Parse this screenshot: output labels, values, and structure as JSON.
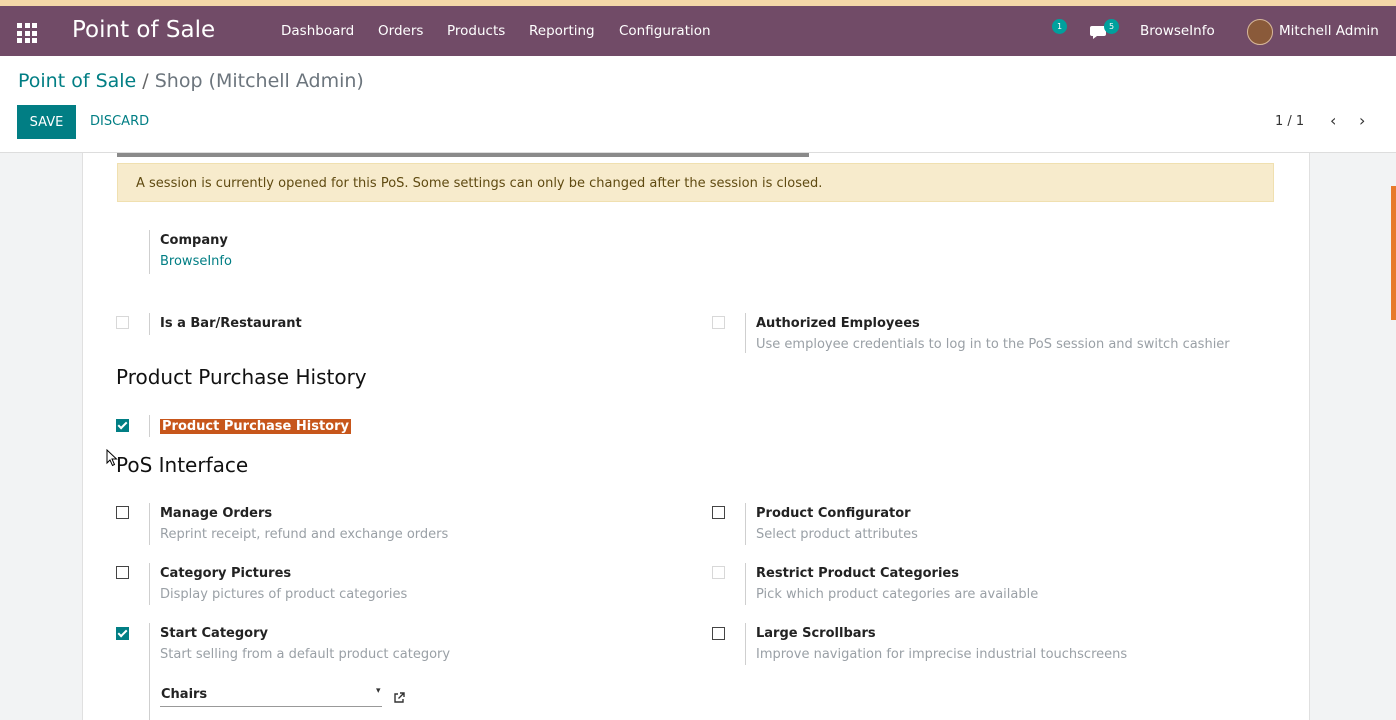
{
  "topbar": {
    "app_title": "Point of Sale",
    "menu": [
      "Dashboard",
      "Orders",
      "Products",
      "Reporting",
      "Configuration"
    ],
    "activity_count": "1",
    "messages_count": "5",
    "company": "BrowseInfo",
    "user": "Mitchell Admin",
    "colors": {
      "bar": "#714b67",
      "accent": "#017e84",
      "badge": "#00a09d"
    }
  },
  "control": {
    "breadcrumb_parent": "Point of Sale",
    "breadcrumb_sep": " / ",
    "breadcrumb_current": "Shop (Mitchell Admin)",
    "save_label": "SAVE",
    "discard_label": "DISCARD",
    "pager": "1 / 1"
  },
  "alert": "A session is currently opened for this PoS. Some settings can only be changed after the session is closed.",
  "company_field": {
    "label": "Company",
    "value": "BrowseInfo"
  },
  "settings_top": {
    "bar_restaurant": {
      "label": "Is a Bar/Restaurant",
      "checked": false
    },
    "authorized_employees": {
      "label": "Authorized Employees",
      "help": "Use employee credentials to log in to the PoS session and switch cashier",
      "checked": false
    }
  },
  "section_history": {
    "title": "Product Purchase History",
    "option_label": "Product Purchase History",
    "checked": true
  },
  "section_interface": {
    "title": "PoS Interface",
    "manage_orders": {
      "label": "Manage Orders",
      "help": "Reprint receipt, refund and exchange orders",
      "checked": false
    },
    "product_configurator": {
      "label": "Product Configurator",
      "help": "Select product attributes",
      "checked": false
    },
    "category_pictures": {
      "label": "Category Pictures",
      "help": "Display pictures of product categories",
      "checked": false
    },
    "restrict_categories": {
      "label": "Restrict Product Categories",
      "help": "Pick which product categories are available",
      "checked": false
    },
    "start_category": {
      "label": "Start Category",
      "help": "Start selling from a default product category",
      "checked": true,
      "value": "Chairs"
    },
    "large_scrollbars": {
      "label": "Large Scrollbars",
      "help": "Improve navigation for imprecise industrial touchscreens",
      "checked": false
    }
  }
}
